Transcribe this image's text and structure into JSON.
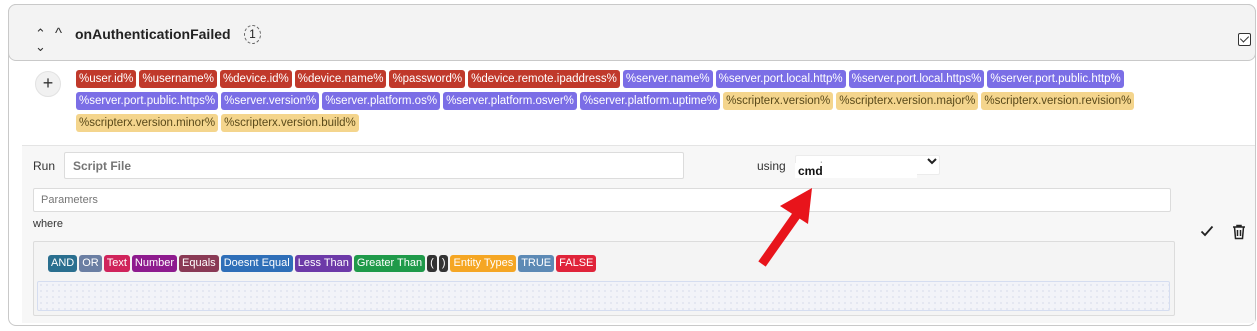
{
  "header": {
    "title": "onAuthenticationFailed",
    "count": "1",
    "expand_icon": "chevrons-up-down-icon",
    "collapse_icon": "caret-up-icon",
    "toggle_icon": "checkbox-checked-icon"
  },
  "add_button": "+",
  "tags": {
    "red": [
      "%user.id%",
      "%username%",
      "%device.id%",
      "%device.name%",
      "%password%",
      "%device.remote.ipaddress%"
    ],
    "blue": [
      "%server.name%",
      "%server.port.local.http%",
      "%server.port.local.https%",
      "%server.port.public.http%",
      "%server.port.public.https%",
      "%server.version%",
      "%server.platform.os%",
      "%server.platform.osver%",
      "%server.platform.uptime%"
    ],
    "yellow": [
      "%scripterx.version%",
      "%scripterx.version.major%",
      "%scripterx.version.revision%",
      "%scripterx.version.minor%",
      "%scripterx.version.build%"
    ]
  },
  "run": {
    "label": "Run",
    "script_placeholder": "Script File",
    "using_label": "using",
    "select_value": "cmd",
    "dropdown_option": "cmd",
    "parameters_placeholder": "Parameters"
  },
  "where_label": "where",
  "operators": [
    {
      "label": "AND",
      "color": "#2a6f8f"
    },
    {
      "label": "OR",
      "color": "#6b7fa3"
    },
    {
      "label": "Text",
      "color": "#d0245b"
    },
    {
      "label": "Number",
      "color": "#8e1b8e"
    },
    {
      "label": "Equals",
      "color": "#8a3a55"
    },
    {
      "label": "Doesnt Equal",
      "color": "#2f6fb8"
    },
    {
      "label": "Less Than",
      "color": "#6d3aa8"
    },
    {
      "label": "Greater Than",
      "color": "#1f9a4a"
    },
    {
      "label": "(",
      "color": "#333333"
    },
    {
      "label": ")",
      "color": "#333333"
    },
    {
      "label": "Entity Types",
      "color": "#f5a623"
    },
    {
      "label": "TRUE",
      "color": "#5d8ab5"
    },
    {
      "label": "FALSE",
      "color": "#e0243a"
    }
  ],
  "actions": {
    "confirm_icon": "check-icon",
    "delete_icon": "trash-icon"
  },
  "colors": {
    "tag_red": "#c0392b",
    "tag_blue": "#7b6ee6",
    "tag_yellow": "#f4d58d",
    "annotation_arrow": "#e8141b"
  }
}
